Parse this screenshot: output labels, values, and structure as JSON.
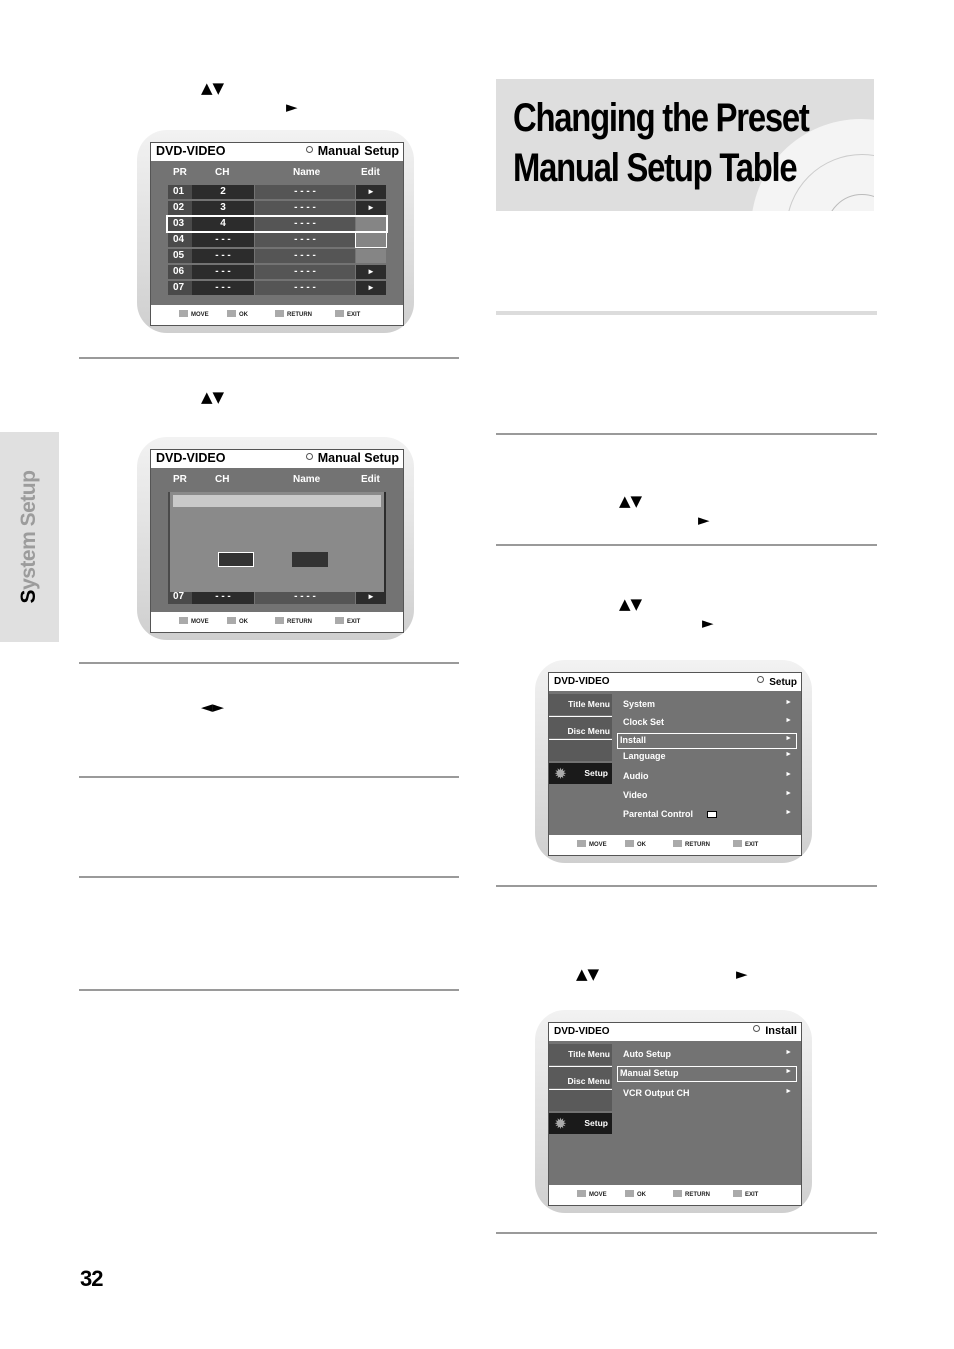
{
  "page": {
    "number": "32",
    "side_tab": {
      "first_letter": "S",
      "rest": "ystem Setup"
    },
    "title_lines": [
      "Changing the Preset",
      "Manual Setup Table"
    ]
  },
  "arrows": {
    "up_down": "▲▼",
    "right": "►",
    "left_right": "◄►"
  },
  "osd_common": {
    "brand": "DVD-VIDEO",
    "footer": [
      "MOVE",
      "OK",
      "RETURN",
      "EXIT"
    ]
  },
  "screen1": {
    "title": "Manual Setup",
    "columns": [
      "PR",
      "CH",
      "Name",
      "Edit"
    ],
    "rows": [
      {
        "pr": "01",
        "ch": "2",
        "name": "- - - -",
        "edit": "►"
      },
      {
        "pr": "02",
        "ch": "3",
        "name": "- - - -",
        "edit": "►"
      },
      {
        "pr": "03",
        "ch": "4",
        "name": "- - - -",
        "edit": ""
      },
      {
        "pr": "04",
        "ch": "- - -",
        "name": "- - - -",
        "edit": ""
      },
      {
        "pr": "05",
        "ch": "- - -",
        "name": "- - - -",
        "edit": ""
      },
      {
        "pr": "06",
        "ch": "- - -",
        "name": "- - - -",
        "edit": "►"
      },
      {
        "pr": "07",
        "ch": "- - -",
        "name": "- - - -",
        "edit": "►"
      }
    ],
    "selected_row": "03"
  },
  "screen2": {
    "title": "Manual Setup",
    "columns": [
      "PR",
      "CH",
      "Name",
      "Edit"
    ],
    "partial_row": {
      "pr": "07",
      "ch": "- - -",
      "name": "- - - -"
    }
  },
  "screen3": {
    "title": "Setup",
    "nav": [
      "Title Menu",
      "Disc Menu",
      "",
      "Setup"
    ],
    "items": [
      "System",
      "Clock Set",
      "Install",
      "Language",
      "Audio",
      "Video",
      "Parental Control"
    ],
    "selected": "Install"
  },
  "screen4": {
    "title": "Install",
    "nav": [
      "Title Menu",
      "Disc Menu",
      "",
      "Setup"
    ],
    "items": [
      "Auto Setup",
      "Manual Setup",
      "VCR Output CH"
    ],
    "selected": "Manual Setup"
  }
}
